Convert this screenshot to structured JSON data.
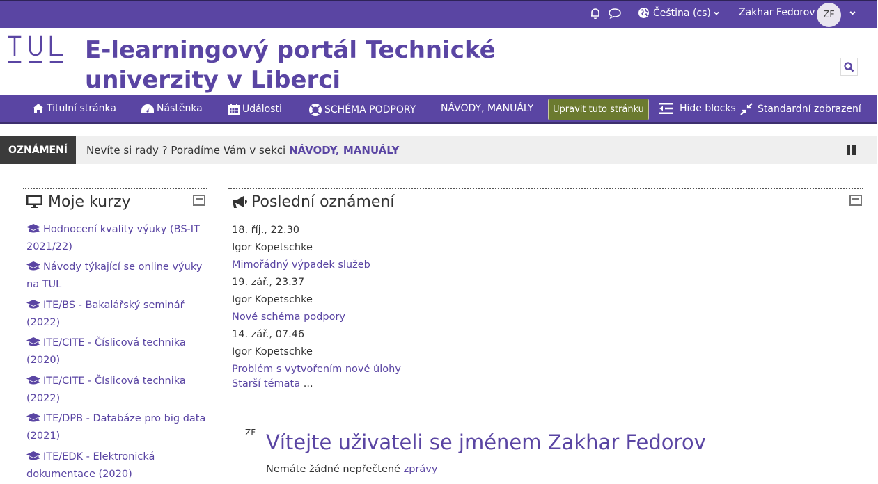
{
  "topbar": {
    "language": "Čeština (cs)",
    "user_name": "Zakhar Fedorov",
    "user_initials": "ZF"
  },
  "header": {
    "logo_text": "TUL",
    "title_line1": "E-learningový portál Technické",
    "title_line2": "univerzity v Liberci"
  },
  "nav": {
    "items": [
      {
        "label": "Titulní stránka",
        "icon": "home-icon"
      },
      {
        "label": "Nástěnka",
        "icon": "dashboard-icon"
      },
      {
        "label": "Události",
        "icon": "calendar-icon"
      },
      {
        "label": "SCHÉMA PODPORY",
        "icon": "lifebuoy-icon"
      },
      {
        "label": "NÁVODY, MANUÁLY",
        "icon": ""
      }
    ],
    "edit_label": "Upravit tuto stránku",
    "hide_blocks_label": "Hide blocks",
    "standard_view_label": "Standardní zobrazení"
  },
  "announcement": {
    "label": "OZNÁMENÍ",
    "text": "Nevíte si rady ? Poradíme Vám v sekci ",
    "link": "NÁVODY, MANUÁLY"
  },
  "my_courses": {
    "title": "Moje kurzy",
    "courses": [
      "Hodnocení kvality výuky (BS-IT 2021/22)",
      "Návody týkající se online výuky na TUL",
      "ITE/BS - Bakalářský seminář (2022)",
      "ITE/CITE - Číslicová technika (2020)",
      "ITE/CITE - Číslicová technika (2022)",
      "ITE/DPB - Databáze pro big data (2021)",
      "ITE/EDK - Elektronická dokumentace (2020)"
    ]
  },
  "news": {
    "title": "Poslední oznámení",
    "items": [
      {
        "date": "18. říj., 22.30",
        "author": "Igor Kopetschke",
        "subject": "Mimořádný výpadek služeb"
      },
      {
        "date": "19. zář., 23.37",
        "author": "Igor Kopetschke",
        "subject": "Nové schéma podpory"
      },
      {
        "date": "14. zář., 07.46",
        "author": "Igor Kopetschke",
        "subject": "Problém s vytvořením nové úlohy"
      }
    ],
    "older_label": "Starší témata",
    "older_suffix": " ..."
  },
  "welcome": {
    "initials": "ZF",
    "heading": "Vítejte uživateli se jménem Zakhar Fedorov",
    "message_prefix": "Nemáte žádné nepřečtené ",
    "message_link": "zprávy"
  },
  "colors": {
    "brand": "#5a45a3",
    "edit_button": "#6b7a2f",
    "announcement_label_bg": "#3b3b3b"
  }
}
